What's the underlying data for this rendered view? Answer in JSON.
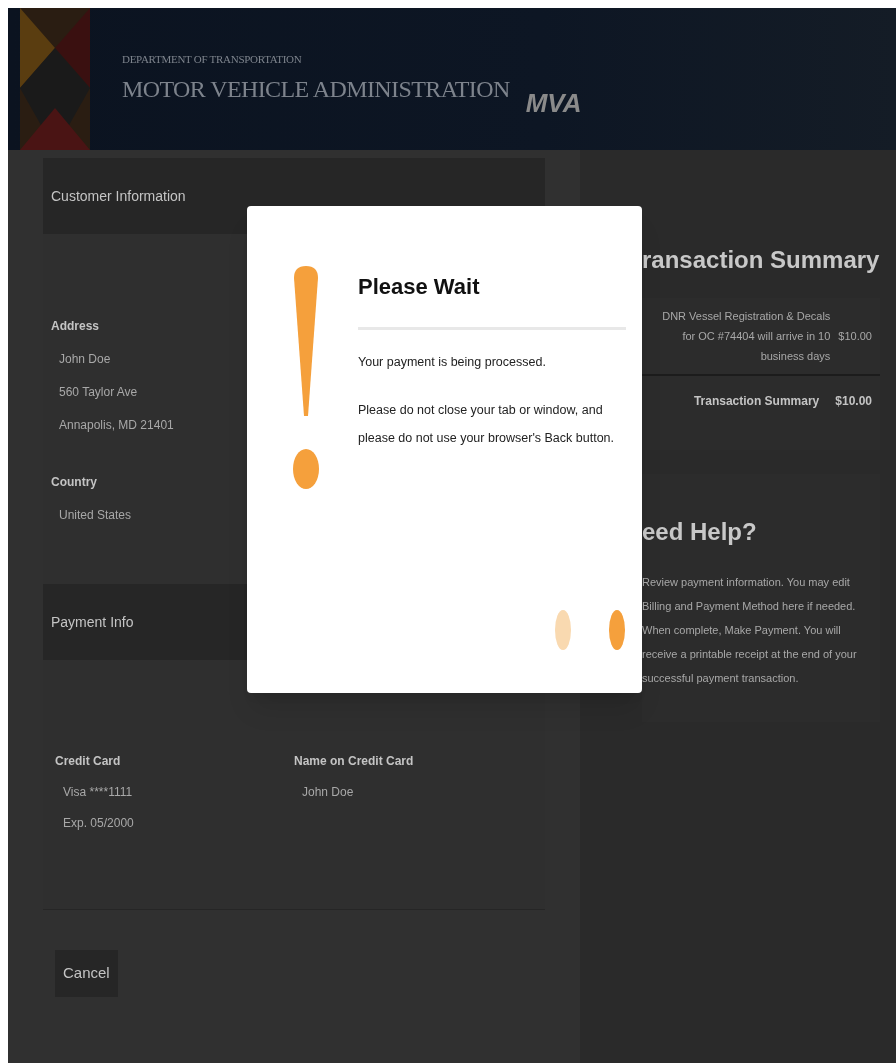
{
  "header": {
    "department": "DEPARTMENT OF TRANSPORTATION",
    "agency": "MOTOR VEHICLE ADMINISTRATION",
    "logo": "MVA"
  },
  "customer_information": {
    "title": "Customer Information",
    "address_label": "Address",
    "address_lines": [
      "John Doe",
      "560 Taylor Ave",
      "Annapolis, MD 21401"
    ],
    "country_label": "Country",
    "country": "United States"
  },
  "payment_info": {
    "title": "Payment Info",
    "credit_card_label": "Credit Card",
    "credit_card_lines": [
      "Visa ****1111",
      "Exp. 05/2000"
    ],
    "name_label": "Name on Credit Card",
    "name": "John Doe"
  },
  "cancel_button": "Cancel",
  "transaction_summary": {
    "title": "ransaction Summary",
    "items": [
      {
        "description": "DNR Vessel Registration & Decals for OC #74404 will arrive in 10 business days",
        "amount": "$10.00"
      }
    ],
    "total_label": "Transaction Summary",
    "total": "$10.00"
  },
  "help": {
    "title": "eed Help?",
    "text": "Review payment information. You may edit Billing and Payment Method here if needed. When complete, Make Payment. You will receive a printable receipt at the end of your successful payment transaction."
  },
  "modal": {
    "title": "Please Wait",
    "messages": [
      "Your payment is being processed.",
      "Please do not close your tab or window, and please do not use your browser's Back button."
    ]
  }
}
